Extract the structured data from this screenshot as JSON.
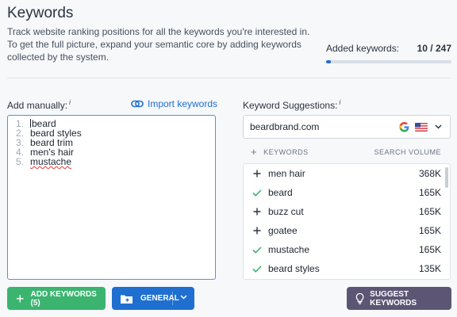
{
  "header": {
    "title": "Keywords",
    "description": "Track website ranking positions for all the keywords you're interested in. To get the full picture, expand your semantic core by adding keywords collected by the system."
  },
  "added": {
    "label": "Added keywords:",
    "count": "10 / 247",
    "progress": 0.04,
    "progress_color": "#1f6fd1"
  },
  "manual": {
    "label": "Add manually:",
    "info": "i",
    "import_label": "Import keywords",
    "lines": [
      {
        "num": "1.",
        "text": "beard"
      },
      {
        "num": "2.",
        "text": "beard styles"
      },
      {
        "num": "3.",
        "text": "beard trim"
      },
      {
        "num": "4.",
        "text": "men's hair"
      },
      {
        "num": "5.",
        "text": "mustache"
      }
    ]
  },
  "suggestions": {
    "label": "Keyword Suggestions:",
    "info": "i",
    "domain": "beardbrand.com",
    "search_engine_icon": "google-icon",
    "country_icon": "us-flag-icon",
    "col_keywords": "KEYWORDS",
    "col_volume": "SEARCH VOLUME",
    "rows": [
      {
        "keyword": "men hair",
        "volume": "368K",
        "added": false
      },
      {
        "keyword": "beard",
        "volume": "165K",
        "added": true
      },
      {
        "keyword": "buzz cut",
        "volume": "165K",
        "added": false
      },
      {
        "keyword": "goatee",
        "volume": "165K",
        "added": false
      },
      {
        "keyword": "mustache",
        "volume": "165K",
        "added": true
      },
      {
        "keyword": "beard styles",
        "volume": "135K",
        "added": true
      }
    ]
  },
  "buttons": {
    "add": "ADD KEYWORDS (5)",
    "general": "GENERAL",
    "suggest": "SUGGEST KEYWORDS"
  },
  "colors": {
    "accent": "#1f6fd1",
    "add_button": "#3bb470",
    "suggest_button": "#5c5674",
    "check": "#3bb470"
  }
}
